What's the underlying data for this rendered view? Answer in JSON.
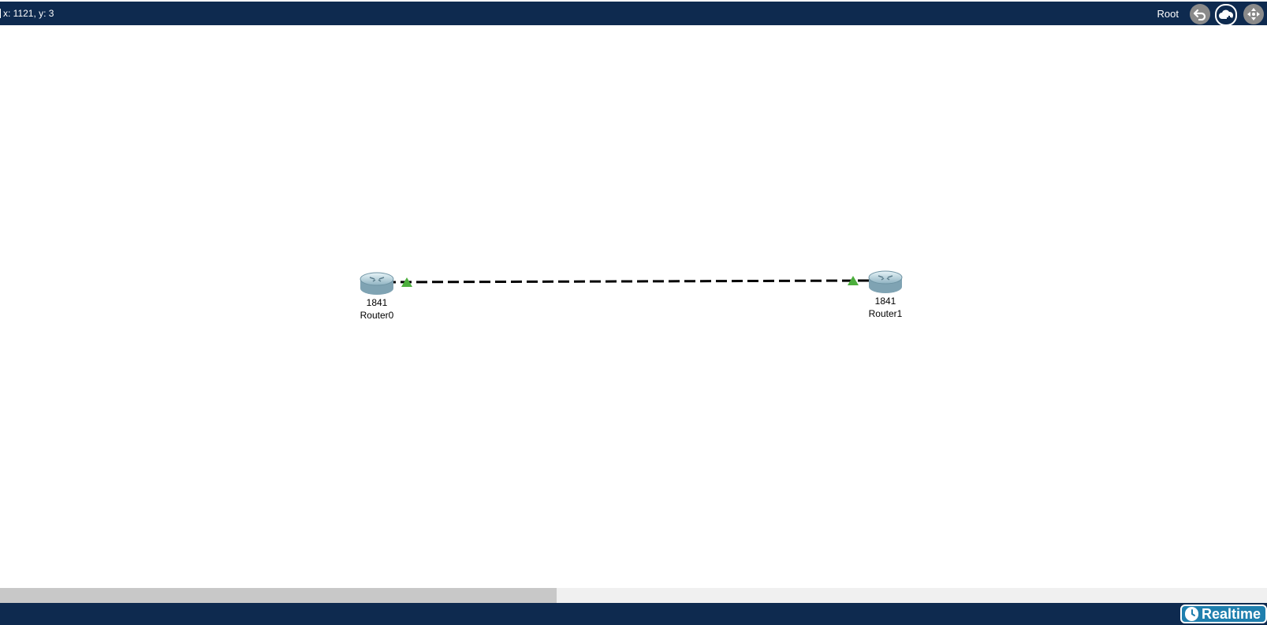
{
  "topbar": {
    "coordinates": "x: 1121, y: 3",
    "workspace_label": "Root",
    "icons": [
      "back-arrow-icon",
      "cloud-add-icon",
      "move-arrows-icon"
    ]
  },
  "devices": [
    {
      "model": "1841",
      "name": "Router0"
    },
    {
      "model": "1841",
      "name": "Router1"
    }
  ],
  "link": {
    "style": "dashed",
    "endpoint_status_color": "#4cae3c"
  },
  "bottombar": {
    "mode_label": "Realtime",
    "icon": "clock-icon"
  },
  "colors": {
    "bar_bg": "#0e2a4f",
    "realtime_bg": "#1f7fae",
    "link_up": "#4cae3c"
  }
}
